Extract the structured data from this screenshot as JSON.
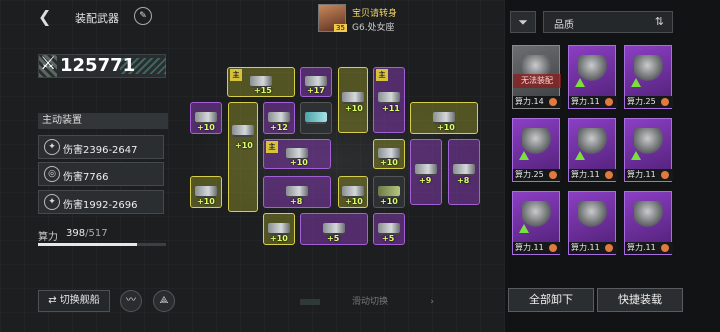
{
  "header": {
    "back_icon": "back-arrow-icon",
    "title": "装配武器",
    "edit_icon": "pen-icon"
  },
  "pilot": {
    "name": "宝贝请转身",
    "subtitle": "G6.处女座",
    "level": "35"
  },
  "power": {
    "icon": "crossed-swords-icon",
    "value": "125771"
  },
  "active_equipment": {
    "title": "主动装置",
    "skills": [
      {
        "icon": "claw-icon",
        "text": "伤害2396-2647"
      },
      {
        "icon": "target-icon",
        "text": "伤害7766"
      },
      {
        "icon": "claw-icon",
        "text": "伤害1992-2696"
      }
    ]
  },
  "calc": {
    "label": "算力",
    "current": "398",
    "max": "/517",
    "fraction": 0.77
  },
  "bottom": {
    "switch_ship": "⇄ 切换舰船",
    "slide_hint": "滑动切换",
    "slide_arrow": "›"
  },
  "slots": {
    "main_tag": "主",
    "levels": [
      "+15",
      "+17",
      "+10",
      "+11",
      "+10",
      "+12",
      "+10",
      "+10",
      "+10",
      "+10",
      "+10",
      "+9",
      "+8",
      "+8",
      "+10",
      "+10",
      "+8",
      "+10",
      "+10",
      "+5",
      "+5",
      "+10"
    ]
  },
  "inventory": {
    "filter_icon": "filter-icon",
    "quality_label": "品质",
    "sort_icon": "sort-toggle-icon",
    "cards": [
      {
        "label": "算力.14",
        "warn": "无法装配",
        "tone": "gray"
      },
      {
        "label": "算力.11",
        "tone": "purple",
        "arrow": true
      },
      {
        "label": "算力.25",
        "tone": "purple",
        "arrow": true
      },
      {
        "label": "算力.25",
        "tone": "purple",
        "arrow": true
      },
      {
        "label": "算力.11",
        "tone": "purple",
        "arrow": true
      },
      {
        "label": "算力.11",
        "tone": "purple",
        "arrow": true
      },
      {
        "label": "算力.11",
        "tone": "purple",
        "arrow": true
      },
      {
        "label": "算力.11",
        "tone": "purple"
      },
      {
        "label": "算力.11",
        "tone": "purple"
      }
    ],
    "unload_all": "全部卸下",
    "quick_equip": "快捷装载"
  }
}
